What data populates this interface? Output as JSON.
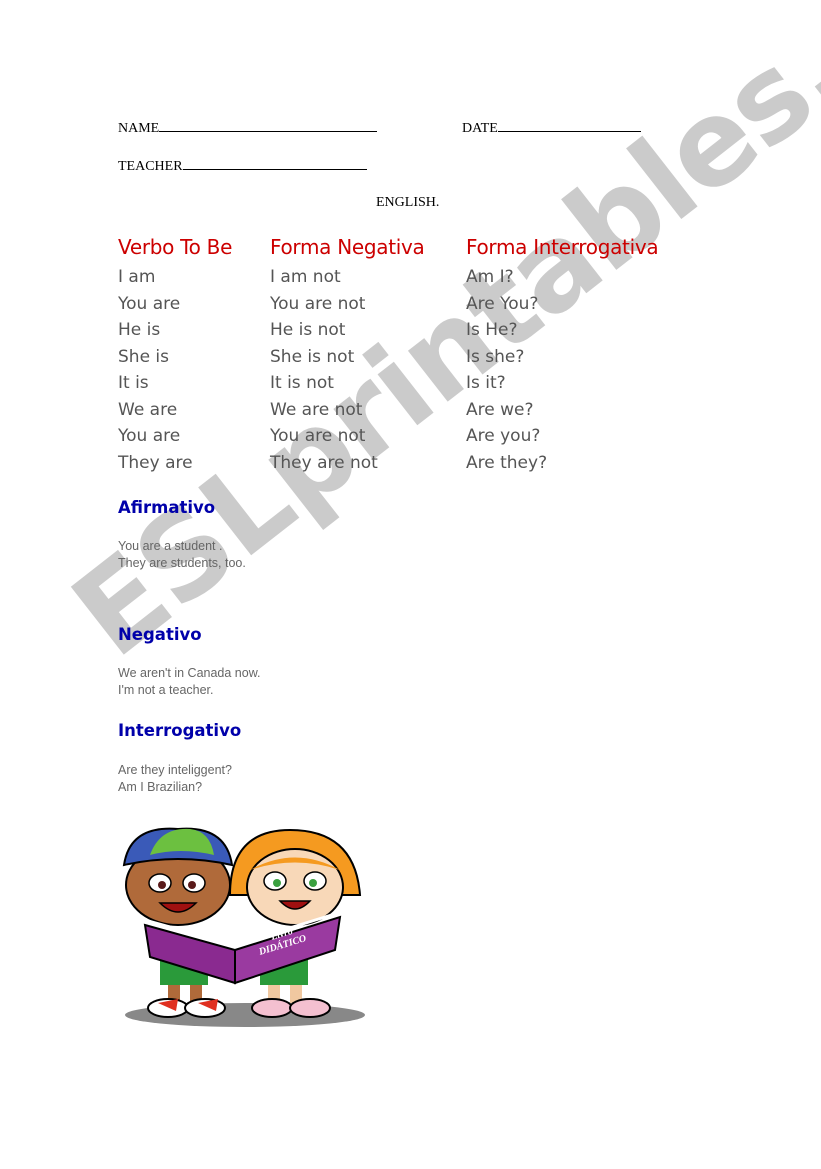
{
  "header": {
    "name_label": "NAME",
    "date_label": "DATE",
    "teacher_label": "TEACHER",
    "subject": "ENGLISH."
  },
  "table": {
    "headers": [
      "Verbo To Be",
      "Forma Negativa",
      "Forma Interrogativa"
    ],
    "affirmative": [
      "I am",
      "You are",
      "He is",
      "She is",
      "It is",
      "We are",
      "You are",
      "They are"
    ],
    "negative": [
      "I am not",
      "You are not",
      "He is not",
      "She is not",
      "It is not",
      "We are not",
      "You are not",
      "They are not"
    ],
    "interrogative": [
      "Am I?",
      "Are You?",
      "Is He?",
      "Is she?",
      "Is it?",
      "Are we?",
      "Are you?",
      "Are they?"
    ]
  },
  "sections": [
    {
      "title": "Afirmativo",
      "lines": [
        "You are a student .",
        "They are students, too."
      ]
    },
    {
      "title": "Negativo",
      "lines": [
        "We aren't in Canada now.",
        "I'm not a teacher."
      ]
    },
    {
      "title": "Interrogativo",
      "lines": [
        "Are they inteliggent?",
        "Am I Brazilian?"
      ]
    }
  ],
  "illustration": {
    "book_text_1": "Livro",
    "book_text_2": "DIDÁTICO"
  },
  "watermark": "ESLprintables.com",
  "colors": {
    "header_red": "#cc0000",
    "section_blue": "#0000aa",
    "body_gray": "#555555"
  }
}
